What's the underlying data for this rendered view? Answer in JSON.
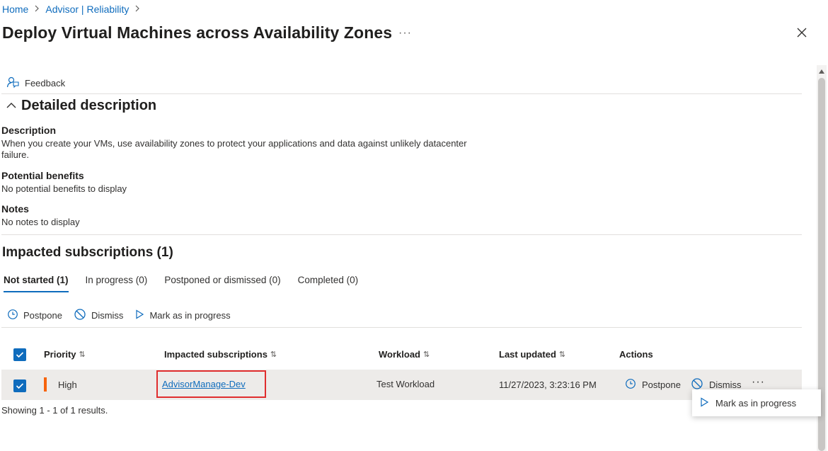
{
  "breadcrumb": {
    "home": "Home",
    "advisor": "Advisor | Reliability"
  },
  "page_title": "Deploy Virtual Machines across Availability Zones",
  "title_more": "···",
  "feedback_label": "Feedback",
  "detailed": {
    "title": "Detailed description",
    "description_label": "Description",
    "description_line1": "When you create your VMs, use availability zones to protect your applications and data against unlikely datacenter",
    "description_line2": "failure.",
    "benefits_label": "Potential benefits",
    "benefits_text": "No potential benefits to display",
    "notes_label": "Notes",
    "notes_text": "No notes to display"
  },
  "impacted": {
    "title": "Impacted subscriptions (1)",
    "tabs": [
      "Not started (1)",
      "In progress (0)",
      "Postponed or dismissed (0)",
      "Completed (0)"
    ],
    "toolbar": {
      "postpone": "Postpone",
      "dismiss": "Dismiss",
      "mark": "Mark as in progress"
    },
    "columns": {
      "priority": "Priority",
      "subscriptions": "Impacted subscriptions",
      "workload": "Workload",
      "last_updated": "Last updated",
      "actions": "Actions"
    },
    "sort_glyph": "⇅",
    "row": {
      "priority": "High",
      "subscription": "AdvisorManage-Dev",
      "workload": "Test Workload",
      "last_updated": "11/27/2023, 3:23:16 PM",
      "postpone": "Postpone",
      "dismiss": "Dismiss",
      "more": "···"
    },
    "showing": "Showing 1 - 1 of 1 results.",
    "popup_mark": "Mark as in progress"
  },
  "colors": {
    "accent": "#0f6cbd",
    "priority_high": "#f7630c",
    "highlight": "#e02d2d"
  }
}
